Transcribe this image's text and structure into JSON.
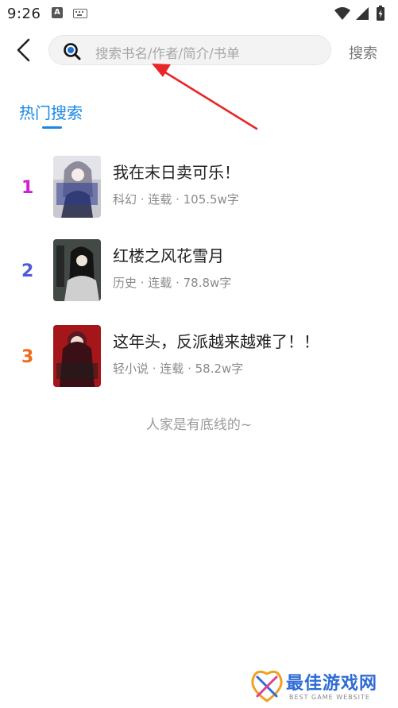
{
  "status_bar": {
    "time": "9:26",
    "a_badge": "A"
  },
  "header": {
    "search_placeholder": "搜索书名/作者/简介/书单",
    "search_button": "搜索"
  },
  "section": {
    "title": "热门搜索"
  },
  "books": [
    {
      "rank": "1",
      "title": "我在末日卖可乐！",
      "meta": "科幻 · 连载 · 105.5w字",
      "rank_color": "#d11fd6",
      "cover_text": "我在末日卖可乐"
    },
    {
      "rank": "2",
      "title": "红楼之风花雪月",
      "meta": "历史 · 连载 · 78.8w字",
      "rank_color": "#4f5bd5",
      "cover_text": "风花雪月"
    },
    {
      "rank": "3",
      "title": "这年头，反派越来越难了！！",
      "meta": "轻小说 · 连载 · 58.2w字",
      "rank_color": "#f06a1a",
      "cover_text": "这年头反派越来越难了"
    }
  ],
  "footer_note": "人家是有底线的~",
  "watermark": {
    "title": "最佳游戏网",
    "subtitle": "BEST GAME WEBSITE"
  },
  "colors": {
    "accent": "#1a88e6",
    "annotation_arrow": "#e8262a"
  }
}
